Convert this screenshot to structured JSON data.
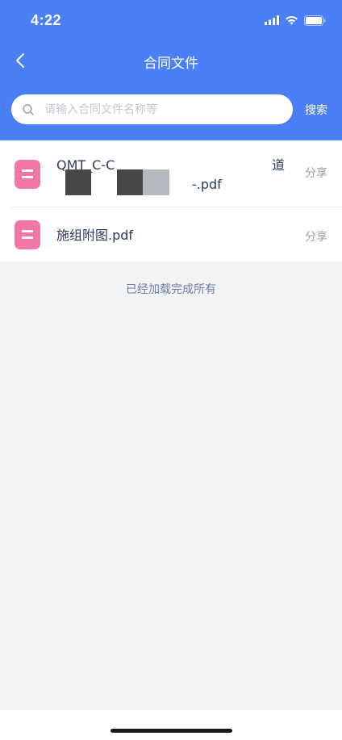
{
  "status_bar": {
    "time": "4:22"
  },
  "nav": {
    "title": "合同文件"
  },
  "search": {
    "placeholder": "请输入合同文件名称等",
    "button_label": "搜索"
  },
  "files": [
    {
      "name_line1": "QMT_C-C",
      "name_line1_end": "道",
      "name_line2_end": "-.pdf",
      "share_label": "分享"
    },
    {
      "name": "施组附图.pdf",
      "share_label": "分享"
    }
  ],
  "list_footer": "已经加载完成所有",
  "colors": {
    "header_bg": "#4a7ff7",
    "file_icon": "#f277a6"
  }
}
